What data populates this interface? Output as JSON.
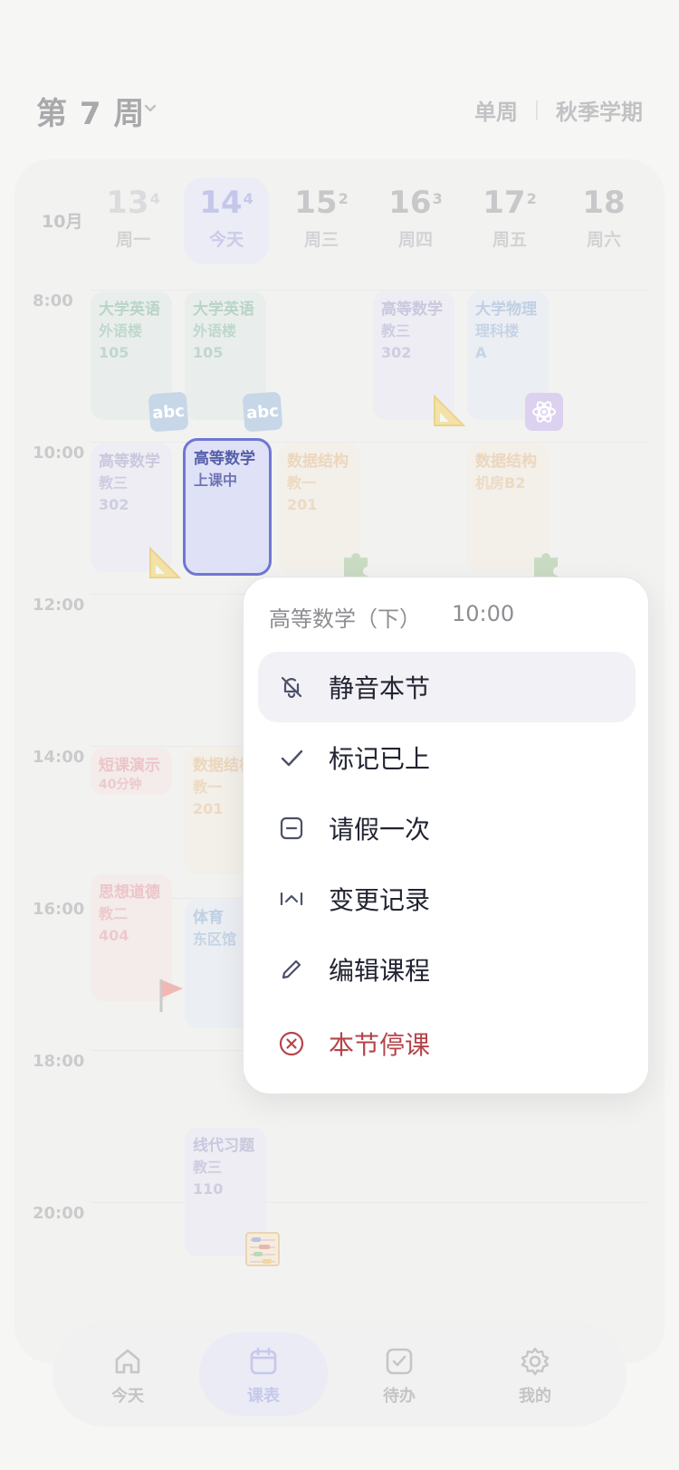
{
  "header": {
    "week_label": "第 7 周",
    "mode": "单周",
    "term": "秋季学期"
  },
  "calendar": {
    "month": "10月",
    "days": [
      {
        "num": "13",
        "sup": "4",
        "weekday": "周一",
        "state": "faded"
      },
      {
        "num": "14",
        "sup": "4",
        "weekday": "今天",
        "state": "today"
      },
      {
        "num": "15",
        "sup": "2",
        "weekday": "周三",
        "state": "normal"
      },
      {
        "num": "16",
        "sup": "3",
        "weekday": "周四",
        "state": "normal"
      },
      {
        "num": "17",
        "sup": "2",
        "weekday": "周五",
        "state": "normal"
      },
      {
        "num": "18",
        "sup": "",
        "weekday": "周六",
        "state": "normal"
      }
    ],
    "times": [
      "8:00",
      "10:00",
      "12:00",
      "14:00",
      "16:00",
      "18:00",
      "20:00"
    ],
    "courses": {
      "mon_8": {
        "name": "大学英语",
        "room1": "外语楼",
        "room2": "105"
      },
      "tue_8": {
        "name": "大学英语",
        "room1": "外语楼",
        "room2": "105"
      },
      "thu_8": {
        "name": "高等数学",
        "room1": "教三",
        "room2": "302"
      },
      "fri_8": {
        "name": "大学物理",
        "room1": "理科楼",
        "room2": "A"
      },
      "mon_10": {
        "name": "高等数学",
        "room1": "教三",
        "room2": "302"
      },
      "tue_10": {
        "name": "高等数学",
        "status": "上课中"
      },
      "wed_10": {
        "name": "数据结构",
        "room1": "教一",
        "room2": "201"
      },
      "fri_10": {
        "name": "数据结构",
        "room1": "机房B2"
      },
      "mon_14": {
        "name": "短课演示",
        "room1": "40分钟"
      },
      "tue_14": {
        "name": "数据结构",
        "room1": "教一",
        "room2": "201"
      },
      "mon_16": {
        "name": "思想道德",
        "room1": "教二",
        "room2": "404"
      },
      "tue_16": {
        "name": "体育",
        "room1": "东区馆"
      },
      "tue_19": {
        "name": "线代习题",
        "room1": "教三",
        "room2": "110"
      }
    },
    "stickers": {
      "abc": "abc"
    }
  },
  "menu": {
    "title": "高等数学（下）",
    "time": "10:00",
    "items": [
      {
        "label": "静音本节",
        "icon": "bell-off-icon"
      },
      {
        "label": "标记已上",
        "icon": "check-icon"
      },
      {
        "label": "请假一次",
        "icon": "minus-square-icon"
      },
      {
        "label": "变更记录",
        "icon": "history-icon"
      },
      {
        "label": "编辑课程",
        "icon": "pencil-icon"
      },
      {
        "label": "本节停课",
        "icon": "x-circle-icon"
      }
    ]
  },
  "nav": [
    {
      "label": "今天",
      "icon": "home-icon"
    },
    {
      "label": "课表",
      "icon": "calendar-icon"
    },
    {
      "label": "待办",
      "icon": "checkbox-icon"
    },
    {
      "label": "我的",
      "icon": "gear-icon"
    }
  ],
  "colors": {
    "accent": "#6f77d2",
    "danger": "#b5444a"
  }
}
